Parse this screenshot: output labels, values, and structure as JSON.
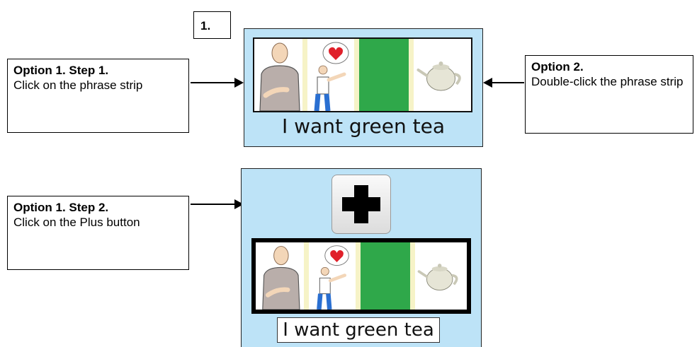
{
  "step_number": "1.",
  "callouts": {
    "option1_step1": {
      "title": "Option 1. Step 1.",
      "text": "Click on the phrase strip"
    },
    "option2": {
      "title": "Option 2.",
      "text": "Double-click the phrase strip"
    },
    "option1_step2": {
      "title": "Option 1. Step 2.",
      "text": "Click on the Plus button"
    }
  },
  "panels": {
    "top": {
      "caption": "I want green tea"
    },
    "bottom": {
      "caption": "I want green tea"
    }
  },
  "symbols": [
    "person-icon",
    "love-icon",
    "green-color-swatch",
    "teapot-icon",
    "plus-icon"
  ],
  "colors": {
    "panel_background": "#bde3f7",
    "green": "#2fa84a",
    "heart": "#e0202a",
    "divider": "#f6f3c7"
  }
}
